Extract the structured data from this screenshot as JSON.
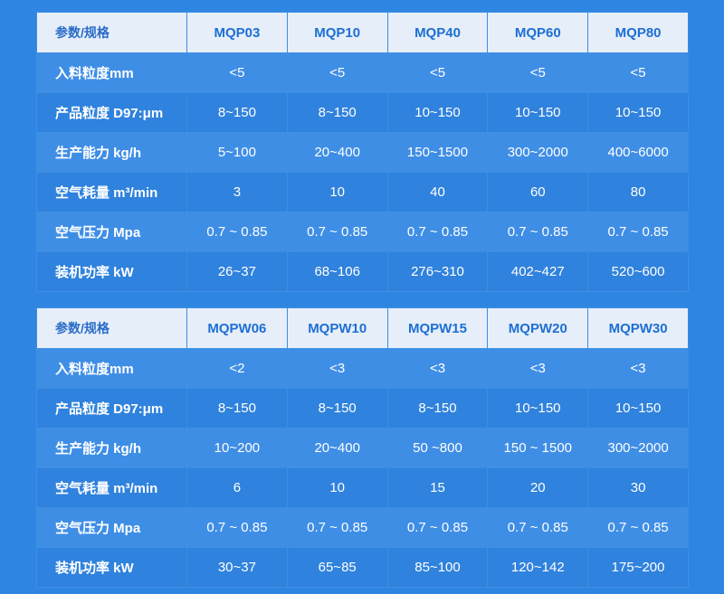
{
  "tables": [
    {
      "header": {
        "corner": "参数/规格",
        "models": [
          "MQP03",
          "MQP10",
          "MQP40",
          "MQP60",
          "MQP80"
        ]
      },
      "rows": [
        {
          "label": "入料粒度mm",
          "values": [
            "<5",
            "<5",
            "<5",
            "<5",
            "<5"
          ]
        },
        {
          "label": "产品粒度 D97:μm",
          "values": [
            "8~150",
            "8~150",
            "10~150",
            "10~150",
            "10~150"
          ]
        },
        {
          "label": "生产能力 kg/h",
          "values": [
            "5~100",
            "20~400",
            "150~1500",
            "300~2000",
            "400~6000"
          ]
        },
        {
          "label": "空气耗量 m³/min",
          "values": [
            "3",
            "10",
            "40",
            "60",
            "80"
          ]
        },
        {
          "label": "空气压力 Mpa",
          "values": [
            "0.7 ~ 0.85",
            "0.7 ~ 0.85",
            "0.7 ~ 0.85",
            "0.7 ~ 0.85",
            "0.7 ~ 0.85"
          ]
        },
        {
          "label": "装机功率 kW",
          "values": [
            "26~37",
            "68~106",
            "276~310",
            "402~427",
            "520~600"
          ]
        }
      ]
    },
    {
      "header": {
        "corner": "参数/规格",
        "models": [
          "MQPW06",
          "MQPW10",
          "MQPW15",
          "MQPW20",
          "MQPW30"
        ]
      },
      "rows": [
        {
          "label": "入料粒度mm",
          "values": [
            "<2",
            "<3",
            "<3",
            "<3",
            "<3"
          ]
        },
        {
          "label": "产品粒度 D97:μm",
          "values": [
            "8~150",
            "8~150",
            "8~150",
            "10~150",
            "10~150"
          ]
        },
        {
          "label": "生产能力 kg/h",
          "values": [
            "10~200",
            "20~400",
            "50 ~800",
            "150 ~ 1500",
            "300~2000"
          ]
        },
        {
          "label": "空气耗量 m³/min",
          "values": [
            "6",
            "10",
            "15",
            "20",
            "30"
          ]
        },
        {
          "label": "空气压力 Mpa",
          "values": [
            "0.7 ~ 0.85",
            "0.7 ~ 0.85",
            "0.7 ~ 0.85",
            "0.7 ~ 0.85",
            "0.7 ~ 0.85"
          ]
        },
        {
          "label": "装机功率 kW",
          "values": [
            "30~37",
            "65~85",
            "85~100",
            "120~142",
            "175~200"
          ]
        }
      ]
    }
  ]
}
